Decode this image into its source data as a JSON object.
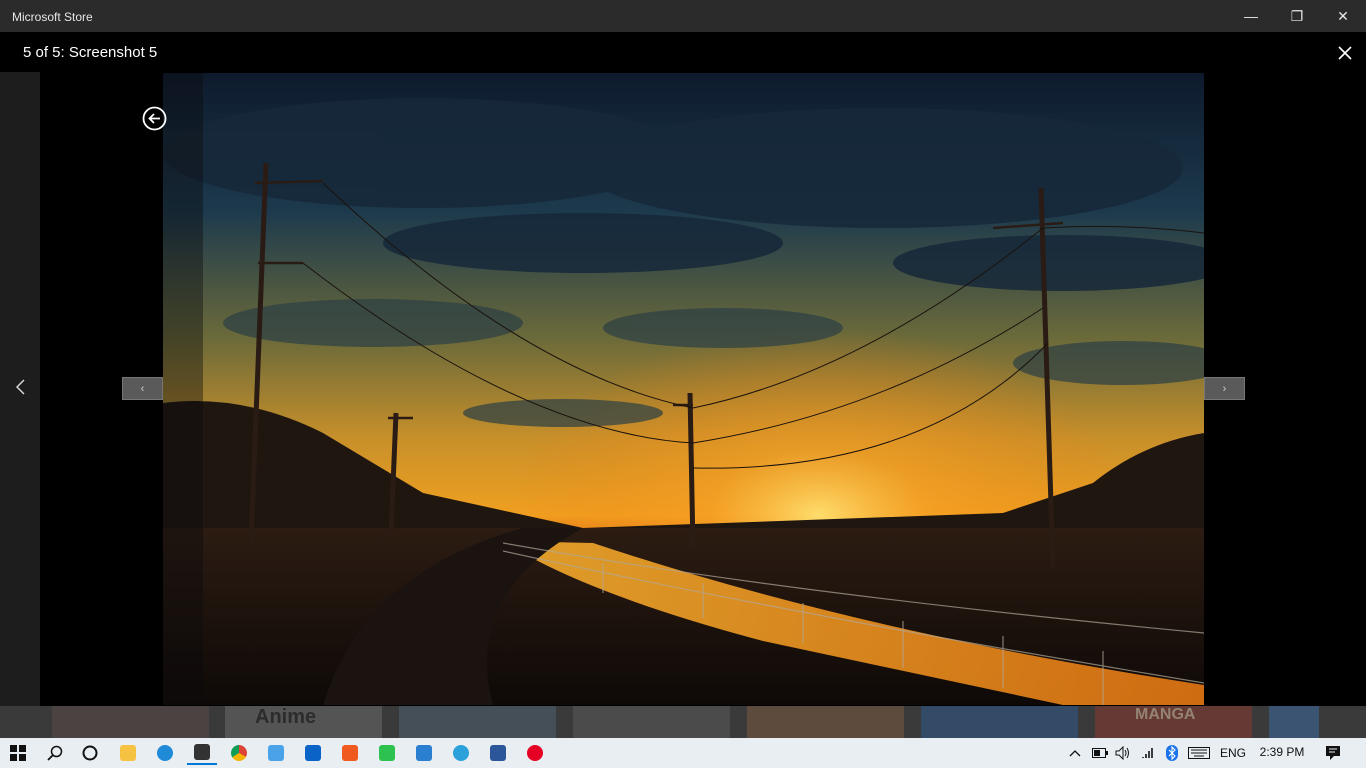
{
  "window": {
    "app_title": "Microsoft Store",
    "minimize_glyph": "—",
    "maximize_glyph": "❐",
    "close_glyph": "✕"
  },
  "viewer": {
    "caption": "5 of 5: Screenshot 5",
    "prev_glyph": "‹",
    "next_glyph": "›"
  },
  "thumbnails": [
    {
      "label": ""
    },
    {
      "label": "Anime"
    },
    {
      "label": ""
    },
    {
      "label": ""
    },
    {
      "label": ""
    },
    {
      "label": ""
    },
    {
      "label": "MANGA"
    },
    {
      "label": ""
    }
  ],
  "taskbar": {
    "icons": [
      "windows-start-icon",
      "search-icon",
      "cortana-icon",
      "file-explorer-icon",
      "edge-icon",
      "store-icon",
      "chrome-icon",
      "this-pc-icon",
      "mail-icon",
      "app-orange-icon",
      "line-icon",
      "photos-icon",
      "telegram-icon",
      "word-icon",
      "pinterest-icon"
    ],
    "language": "ENG",
    "time": "2:39 PM"
  },
  "colors": {
    "accent": "#0078d7",
    "titlebar": "#2b2b2b",
    "viewer_bg": "#000000"
  }
}
